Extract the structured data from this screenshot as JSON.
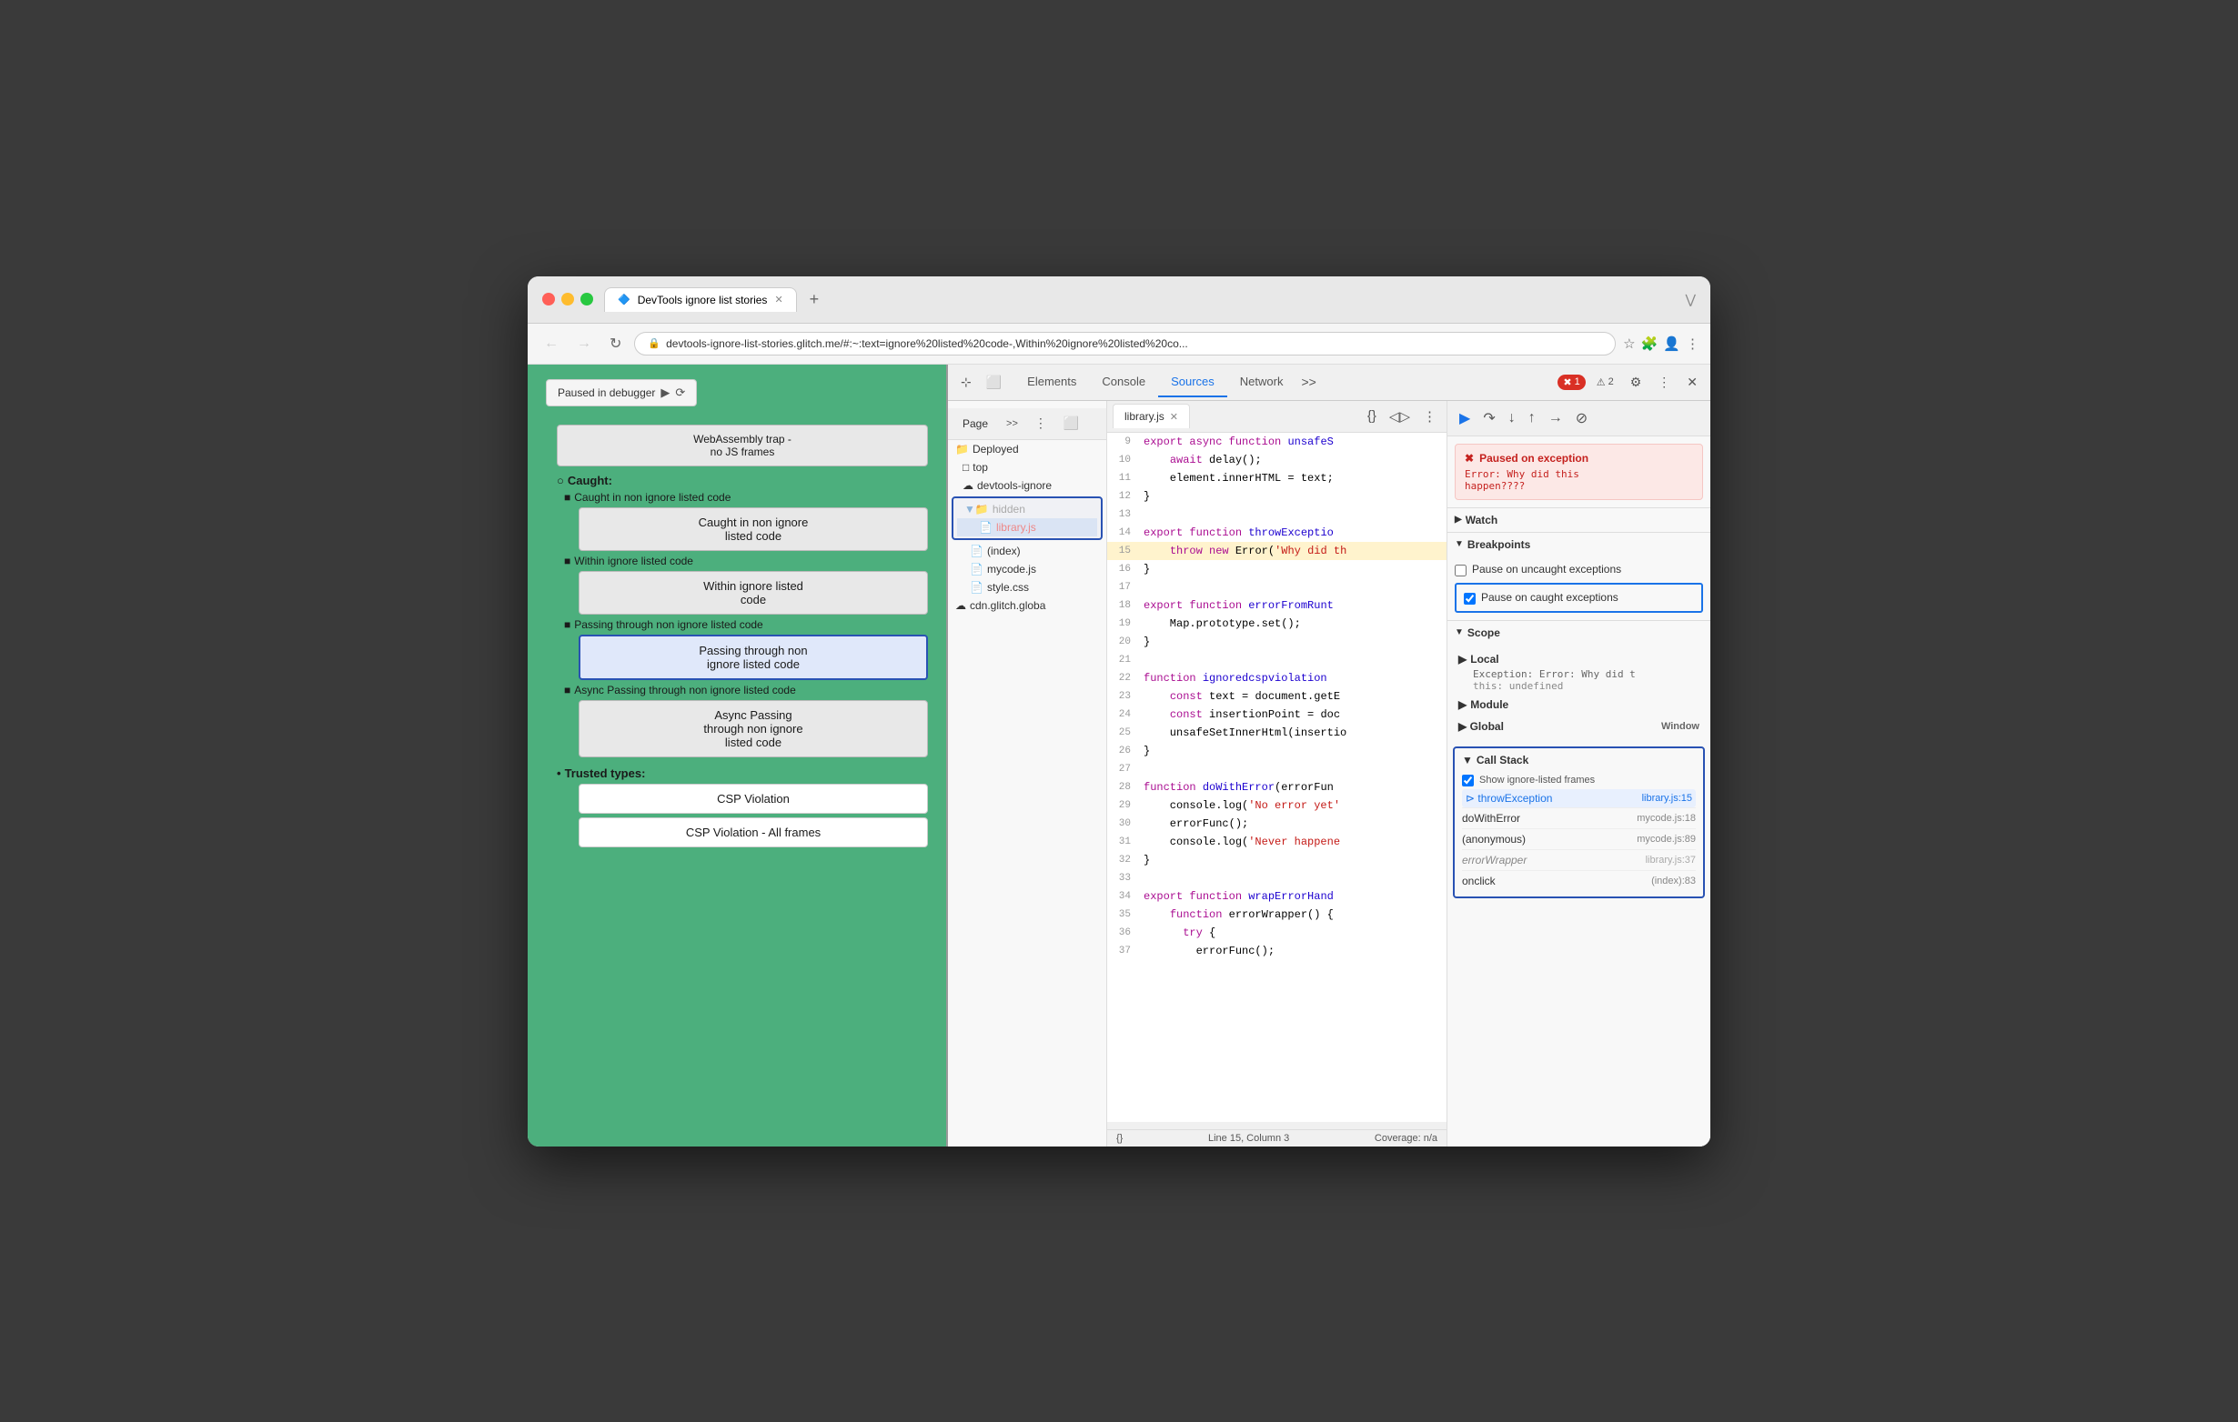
{
  "browser": {
    "tab_title": "DevTools ignore list stories",
    "url": "devtools-ignore-list-stories.glitch.me/#:~:text=ignore%20listed%20code-,Within%20ignore%20listed%20co...",
    "tab_icon": "🔷"
  },
  "page": {
    "paused_banner": "Paused in debugger",
    "sections": {
      "caught_header": "Caught:",
      "caught_items": [
        "Caught in non ignore listed code",
        "Within ignore listed code",
        "Passing through non ignore listed code",
        "Async Passing through non ignore listed code"
      ],
      "trusted_types_header": "Trusted types:",
      "trusted_types_items": [
        "CSP Violation",
        "CSP Violation - All frames"
      ],
      "webassembly_item": "WebAssembly trap - no JS frames"
    },
    "buttons": {
      "caught_non_ignore": "Caught in non ignore\nlisted code",
      "within_ignore": "Within ignore listed\ncode",
      "passing_through": "Passing through non\nignore listed code",
      "async_passing": "Async Passing\nthrough non ignore\nlisted code",
      "csp_violation": "CSP Violation",
      "csp_violation_all": "CSP Violation - All frames"
    }
  },
  "devtools": {
    "tabs": [
      "Elements",
      "Console",
      "Sources",
      "Network"
    ],
    "active_tab": "Sources",
    "error_count": "1",
    "warning_count": "2",
    "page_nav": {
      "page_label": "Page",
      "file_name": "library.js"
    },
    "file_tree": {
      "deployed_label": "Deployed",
      "top_label": "top",
      "devtools_ignore_label": "devtools-ignore",
      "hidden_label": "hidden",
      "library_js_label": "library.js",
      "index_label": "(index)",
      "mycode_js_label": "mycode.js",
      "style_css_label": "style.css",
      "cdn_glitch_label": "cdn.glitch.globa"
    },
    "source_tab_label": "library.js",
    "code_lines": [
      {
        "num": 9,
        "content": "  export async function unsafeS",
        "highlight": false
      },
      {
        "num": 10,
        "content": "    await delay();",
        "highlight": false
      },
      {
        "num": 11,
        "content": "    element.innerHTML = text;",
        "highlight": false
      },
      {
        "num": 12,
        "content": "}",
        "highlight": false
      },
      {
        "num": 13,
        "content": "",
        "highlight": false
      },
      {
        "num": 14,
        "content": "  export function throwExceptio",
        "highlight": false
      },
      {
        "num": 15,
        "content": "    throw new Error('Why did th",
        "highlight": true
      },
      {
        "num": 16,
        "content": "}",
        "highlight": false
      },
      {
        "num": 17,
        "content": "",
        "highlight": false
      },
      {
        "num": 18,
        "content": "  export function errorFromRunt",
        "highlight": false
      },
      {
        "num": 19,
        "content": "    Map.prototype.set();",
        "highlight": false
      },
      {
        "num": 20,
        "content": "}",
        "highlight": false
      },
      {
        "num": 21,
        "content": "",
        "highlight": false
      },
      {
        "num": 22,
        "content": "  function ignoredcspviolation",
        "highlight": false
      },
      {
        "num": 23,
        "content": "    const text = document.getE",
        "highlight": false
      },
      {
        "num": 24,
        "content": "    const insertionPoint = doc",
        "highlight": false
      },
      {
        "num": 25,
        "content": "    unsafeSetInnerHtml(insertio",
        "highlight": false
      },
      {
        "num": 26,
        "content": "}",
        "highlight": false
      },
      {
        "num": 27,
        "content": "",
        "highlight": false
      },
      {
        "num": 28,
        "content": "  function doWithError(errorFun",
        "highlight": false
      },
      {
        "num": 29,
        "content": "    console.log('No error yet'",
        "highlight": false
      },
      {
        "num": 30,
        "content": "    errorFunc();",
        "highlight": false
      },
      {
        "num": 31,
        "content": "    console.log('Never happene",
        "highlight": false
      },
      {
        "num": 32,
        "content": "}",
        "highlight": false
      },
      {
        "num": 33,
        "content": "",
        "highlight": false
      },
      {
        "num": 34,
        "content": "  export function wrapErrorHand",
        "highlight": false
      },
      {
        "num": 35,
        "content": "    function errorWrapper() {",
        "highlight": false
      },
      {
        "num": 36,
        "content": "      try {",
        "highlight": false
      },
      {
        "num": 37,
        "content": "        errorFunc();",
        "highlight": false
      }
    ],
    "status_bar": {
      "position": "Line 15, Column 3",
      "coverage": "Coverage: n/a"
    },
    "debugger": {
      "exception_title": "Paused on exception",
      "exception_error": "Error: Why did this\nhappen????",
      "watch_label": "Watch",
      "breakpoints_label": "Breakpoints",
      "pause_uncaught": "Pause on uncaught exceptions",
      "pause_caught": "Pause on caught exceptions",
      "pause_caught_checked": true,
      "scope_label": "Scope",
      "local_label": "Local",
      "exception_detail": "Exception: Error: Why did t",
      "this_value": "this:  undefined",
      "module_label": "Module",
      "global_label": "Global",
      "global_value": "Window",
      "call_stack_label": "Call Stack",
      "show_ignore_label": "Show ignore-listed frames",
      "show_ignore_checked": true,
      "call_stack_items": [
        {
          "fn": "throwException",
          "loc": "library.js:15",
          "active": true,
          "muted": false
        },
        {
          "fn": "doWithError",
          "loc": "mycode.js:18",
          "active": false,
          "muted": false
        },
        {
          "fn": "(anonymous)",
          "loc": "mycode.js:89",
          "active": false,
          "muted": false
        },
        {
          "fn": "errorWrapper",
          "loc": "library.js:37",
          "active": false,
          "muted": true
        },
        {
          "fn": "onclick",
          "loc": "(index):83",
          "active": false,
          "muted": false
        }
      ]
    }
  }
}
